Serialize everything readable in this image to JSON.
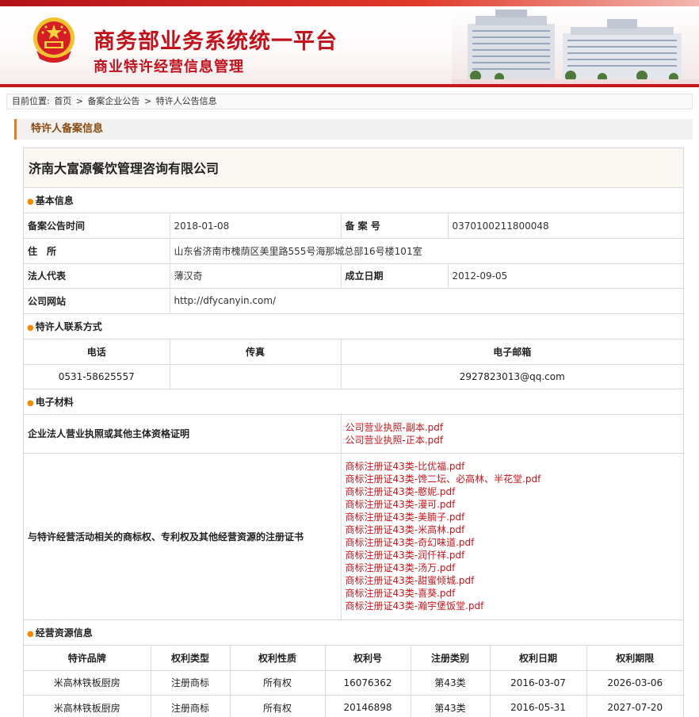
{
  "header": {
    "title_main": "商务部业务系统统一平台",
    "title_sub": "商业特许经营信息管理"
  },
  "breadcrumb": {
    "prefix": "目前位置:",
    "items": [
      "首页",
      "备案企业公告",
      "特许人公告信息"
    ],
    "separator": ">"
  },
  "section": {
    "title": "特许人备案信息"
  },
  "company": {
    "name": "济南大富源餐饮管理咨询有限公司"
  },
  "basic_info": {
    "heading": "基本信息",
    "announce_time_label": "备案公告时间",
    "announce_time": "2018-01-08",
    "record_no_label": "备 案 号",
    "record_no": "0370100211800048",
    "address_label": "住　所",
    "address": "山东省济南市槐荫区美里路555号海那城总部16号楼101室",
    "legal_rep_label": "法人代表",
    "legal_rep": "薄汉奇",
    "founded_label": "成立日期",
    "founded": "2012-09-05",
    "website_label": "公司网站",
    "website": "http://dfycanyin.com/"
  },
  "contact": {
    "heading": "特许人联系方式",
    "phone_label": "电话",
    "fax_label": "传真",
    "email_label": "电子邮箱",
    "phone": "0531-58625557",
    "fax": "",
    "email": "2927823013@qq.com"
  },
  "materials": {
    "heading": "电子材料",
    "license_label": "企业法人营业执照或其他主体资格证明",
    "license_files": [
      "公司营业执照-副本.pdf",
      "公司营业执照-正本.pdf"
    ],
    "trademark_label": "与特许经营活动相关的商标权、专利权及其他经营资源的注册证书",
    "trademark_files": [
      "商标注册证43类-比优福.pdf",
      "商标注册证43类-馋二坛、必高林、半花堂.pdf",
      "商标注册证43类-憨妮.pdf",
      "商标注册证43类-漫可.pdf",
      "商标注册证43类-美腩子.pdf",
      "商标注册证43类-米高林.pdf",
      "商标注册证43类-奇幻味道.pdf",
      "商标注册证43类-润仟祥.pdf",
      "商标注册证43类-汤万.pdf",
      "商标注册证43类-甜蜜倾城.pdf",
      "商标注册证43类-喜葵.pdf",
      "商标注册证43类-瀚宇堡饭堂.pdf"
    ]
  },
  "resources": {
    "heading": "经营资源信息",
    "columns": [
      "特许品牌",
      "权利类型",
      "权利性质",
      "权利号",
      "注册类别",
      "权利日期",
      "权利期限"
    ],
    "rows": [
      [
        "米高林铁板厨房",
        "注册商标",
        "所有权",
        "16076362",
        "第43类",
        "2016-03-07",
        "2026-03-06"
      ],
      [
        "米高林铁板厨房",
        "注册商标",
        "所有权",
        "20146898",
        "第43类",
        "2016-05-31",
        "2027-07-20"
      ]
    ]
  },
  "colors": {
    "brand_red": "#c8161d",
    "accent_orange": "#e67e22"
  }
}
